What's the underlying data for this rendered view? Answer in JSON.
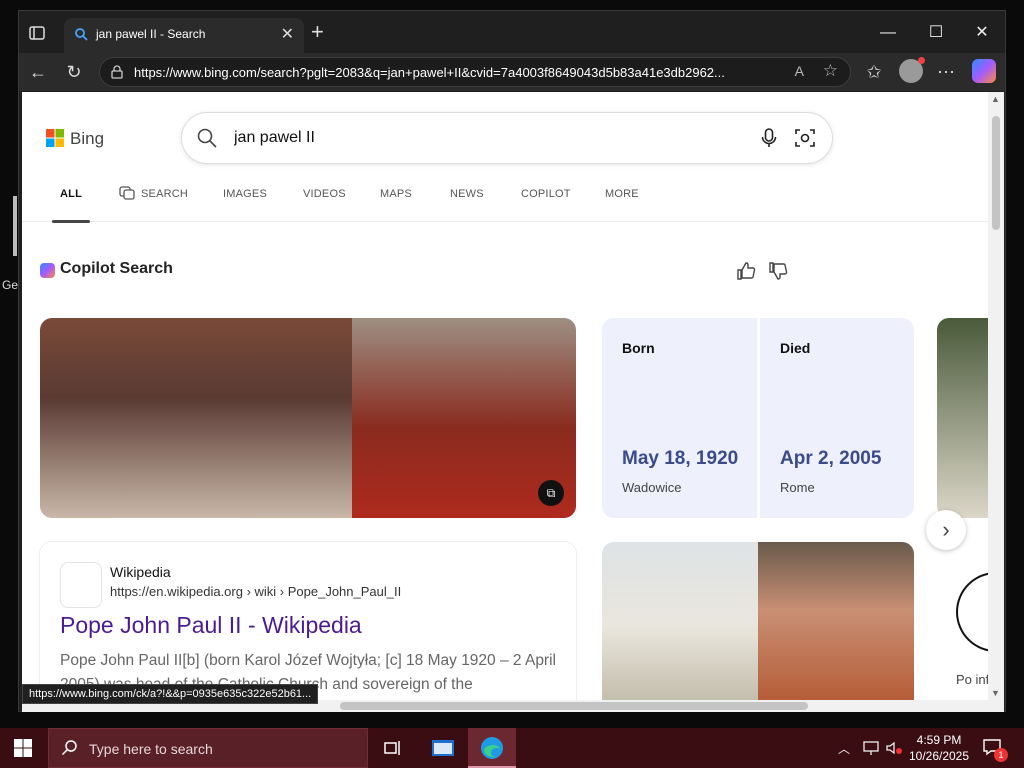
{
  "browser": {
    "tab_title": "jan pawel II - Search",
    "url": "https://www.bing.com/search?pglt=2083&q=jan+pawel+II&cvid=7a4003f8649043d5b83a41e3db2962...",
    "read_aloud_label": "A",
    "status_link": "https://www.bing.com/ck/a?!&&p=0935e635c322e52b61..."
  },
  "desktop": {
    "side_label": "Ge"
  },
  "bing": {
    "logo_text": "Bing",
    "query": "jan pawel II",
    "scopes": [
      "ALL",
      "SEARCH",
      "IMAGES",
      "VIDEOS",
      "MAPS",
      "NEWS",
      "COPILOT",
      "MORE"
    ],
    "copilot_title": "Copilot Search"
  },
  "facts": [
    {
      "label": "Born",
      "value": "May 18, 1920",
      "place": "Wadowice"
    },
    {
      "label": "Died",
      "value": "Apr 2, 2005",
      "place": "Rome"
    }
  ],
  "result": {
    "site_name": "Wikipedia",
    "cite": "https://en.wikipedia.org › wiki › Pope_John_Paul_II",
    "title": "Pope John Paul II - Wikipedia",
    "snippet": "Pope John Paul II[b] (born Karol Józef Wojtyła; [c] 18 May 1920 – 2 April 2005) was head of the Catholic Church and sovereign of the"
  },
  "peek_text": "Po inf",
  "taskbar": {
    "search_placeholder": "Type here to search",
    "time": "4:59 PM",
    "date": "10/26/2025",
    "notification_count": "1"
  },
  "colors": {
    "taskbar_bg": "#3a0d12",
    "result_title": "#4b1b94",
    "fact_value": "#3b4a8a",
    "facts_bg": "#eef1fb"
  }
}
